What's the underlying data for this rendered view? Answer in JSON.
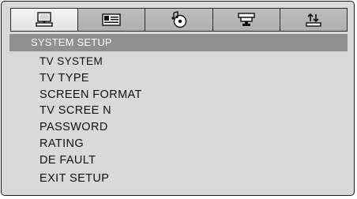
{
  "tabs": [
    {
      "icon": "general-setup-icon",
      "active": true
    },
    {
      "icon": "audio-setup-icon",
      "active": false
    },
    {
      "icon": "dolby-digital-setup-icon",
      "active": false
    },
    {
      "icon": "video-setup-icon",
      "active": false
    },
    {
      "icon": "preference-setup-icon",
      "active": false
    }
  ],
  "header": {
    "title": "SYSTEM SETUP"
  },
  "menu": {
    "items": [
      "TV SYSTEM",
      "TV TYPE",
      "SCREEN FORMAT",
      "TV SCREE N",
      "PASSWORD",
      "RATING",
      "DE FAULT",
      "EXIT SETUP"
    ]
  },
  "colors": {
    "panel_background": "#d9d9d9",
    "header_background": "#8f8f8f",
    "header_text": "#ffffff",
    "item_text": "#111111",
    "tab_active": "#eeeeee",
    "tab_inactive": "#b6b6b6"
  }
}
